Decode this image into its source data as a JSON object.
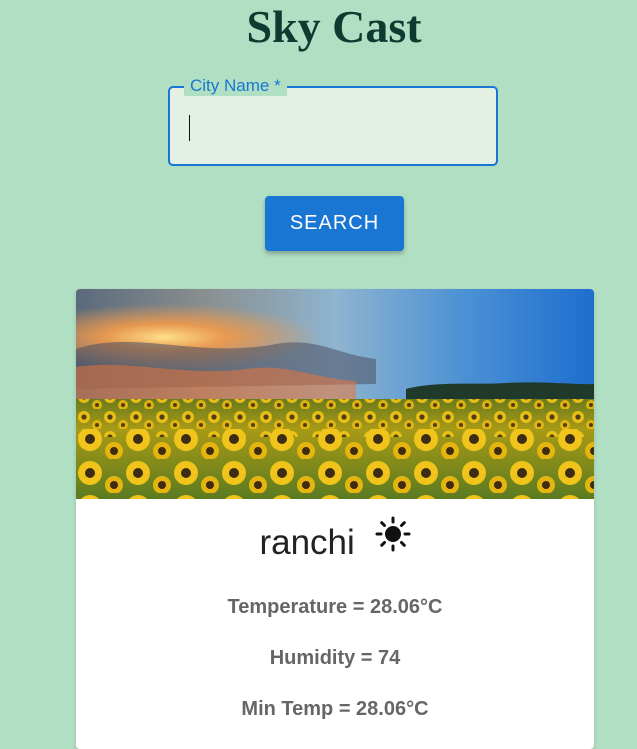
{
  "app": {
    "title": "Sky Cast"
  },
  "search": {
    "label": "City Name *",
    "value": "",
    "button_label": "SEARCH"
  },
  "weather": {
    "city": "ranchi",
    "condition_icon": "sun-icon",
    "temperature": "Temperature = 28.06°C",
    "humidity": "Humidity = 74",
    "min_temp": "Min Temp = 28.06°C"
  },
  "colors": {
    "background": "#b1dfc3",
    "accent": "#1976d2",
    "title": "#0d3b30"
  }
}
